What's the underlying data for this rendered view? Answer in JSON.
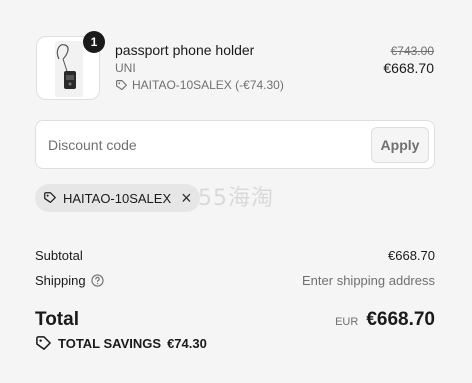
{
  "line_item": {
    "quantity": "1",
    "name": "passport phone holder",
    "variant": "UNI",
    "discount_label": "HAITAO-10SALEX (-€74.30)",
    "price_original": "€743.00",
    "price_final": "€668.70"
  },
  "discount": {
    "placeholder": "Discount code",
    "apply_label": "Apply"
  },
  "applied_code": {
    "code": "HAITAO-10SALEX",
    "remove_glyph": "×"
  },
  "watermark": "55海淘",
  "summary": {
    "subtotal_label": "Subtotal",
    "subtotal_value": "€668.70",
    "shipping_label": "Shipping",
    "shipping_value": "Enter shipping address",
    "total_label": "Total",
    "currency": "EUR",
    "total_value": "€668.70",
    "savings_label": "TOTAL SAVINGS",
    "savings_value": "€74.30"
  },
  "icons": {
    "tag": "tag-icon",
    "help": "question-circle-icon",
    "remove": "close-icon",
    "savings": "price-tag-icon"
  },
  "colors": {
    "background": "#f5f5f5",
    "text": "#1a1a1a",
    "muted": "#707070",
    "border": "#dedede",
    "chip": "#e6e6e6"
  }
}
